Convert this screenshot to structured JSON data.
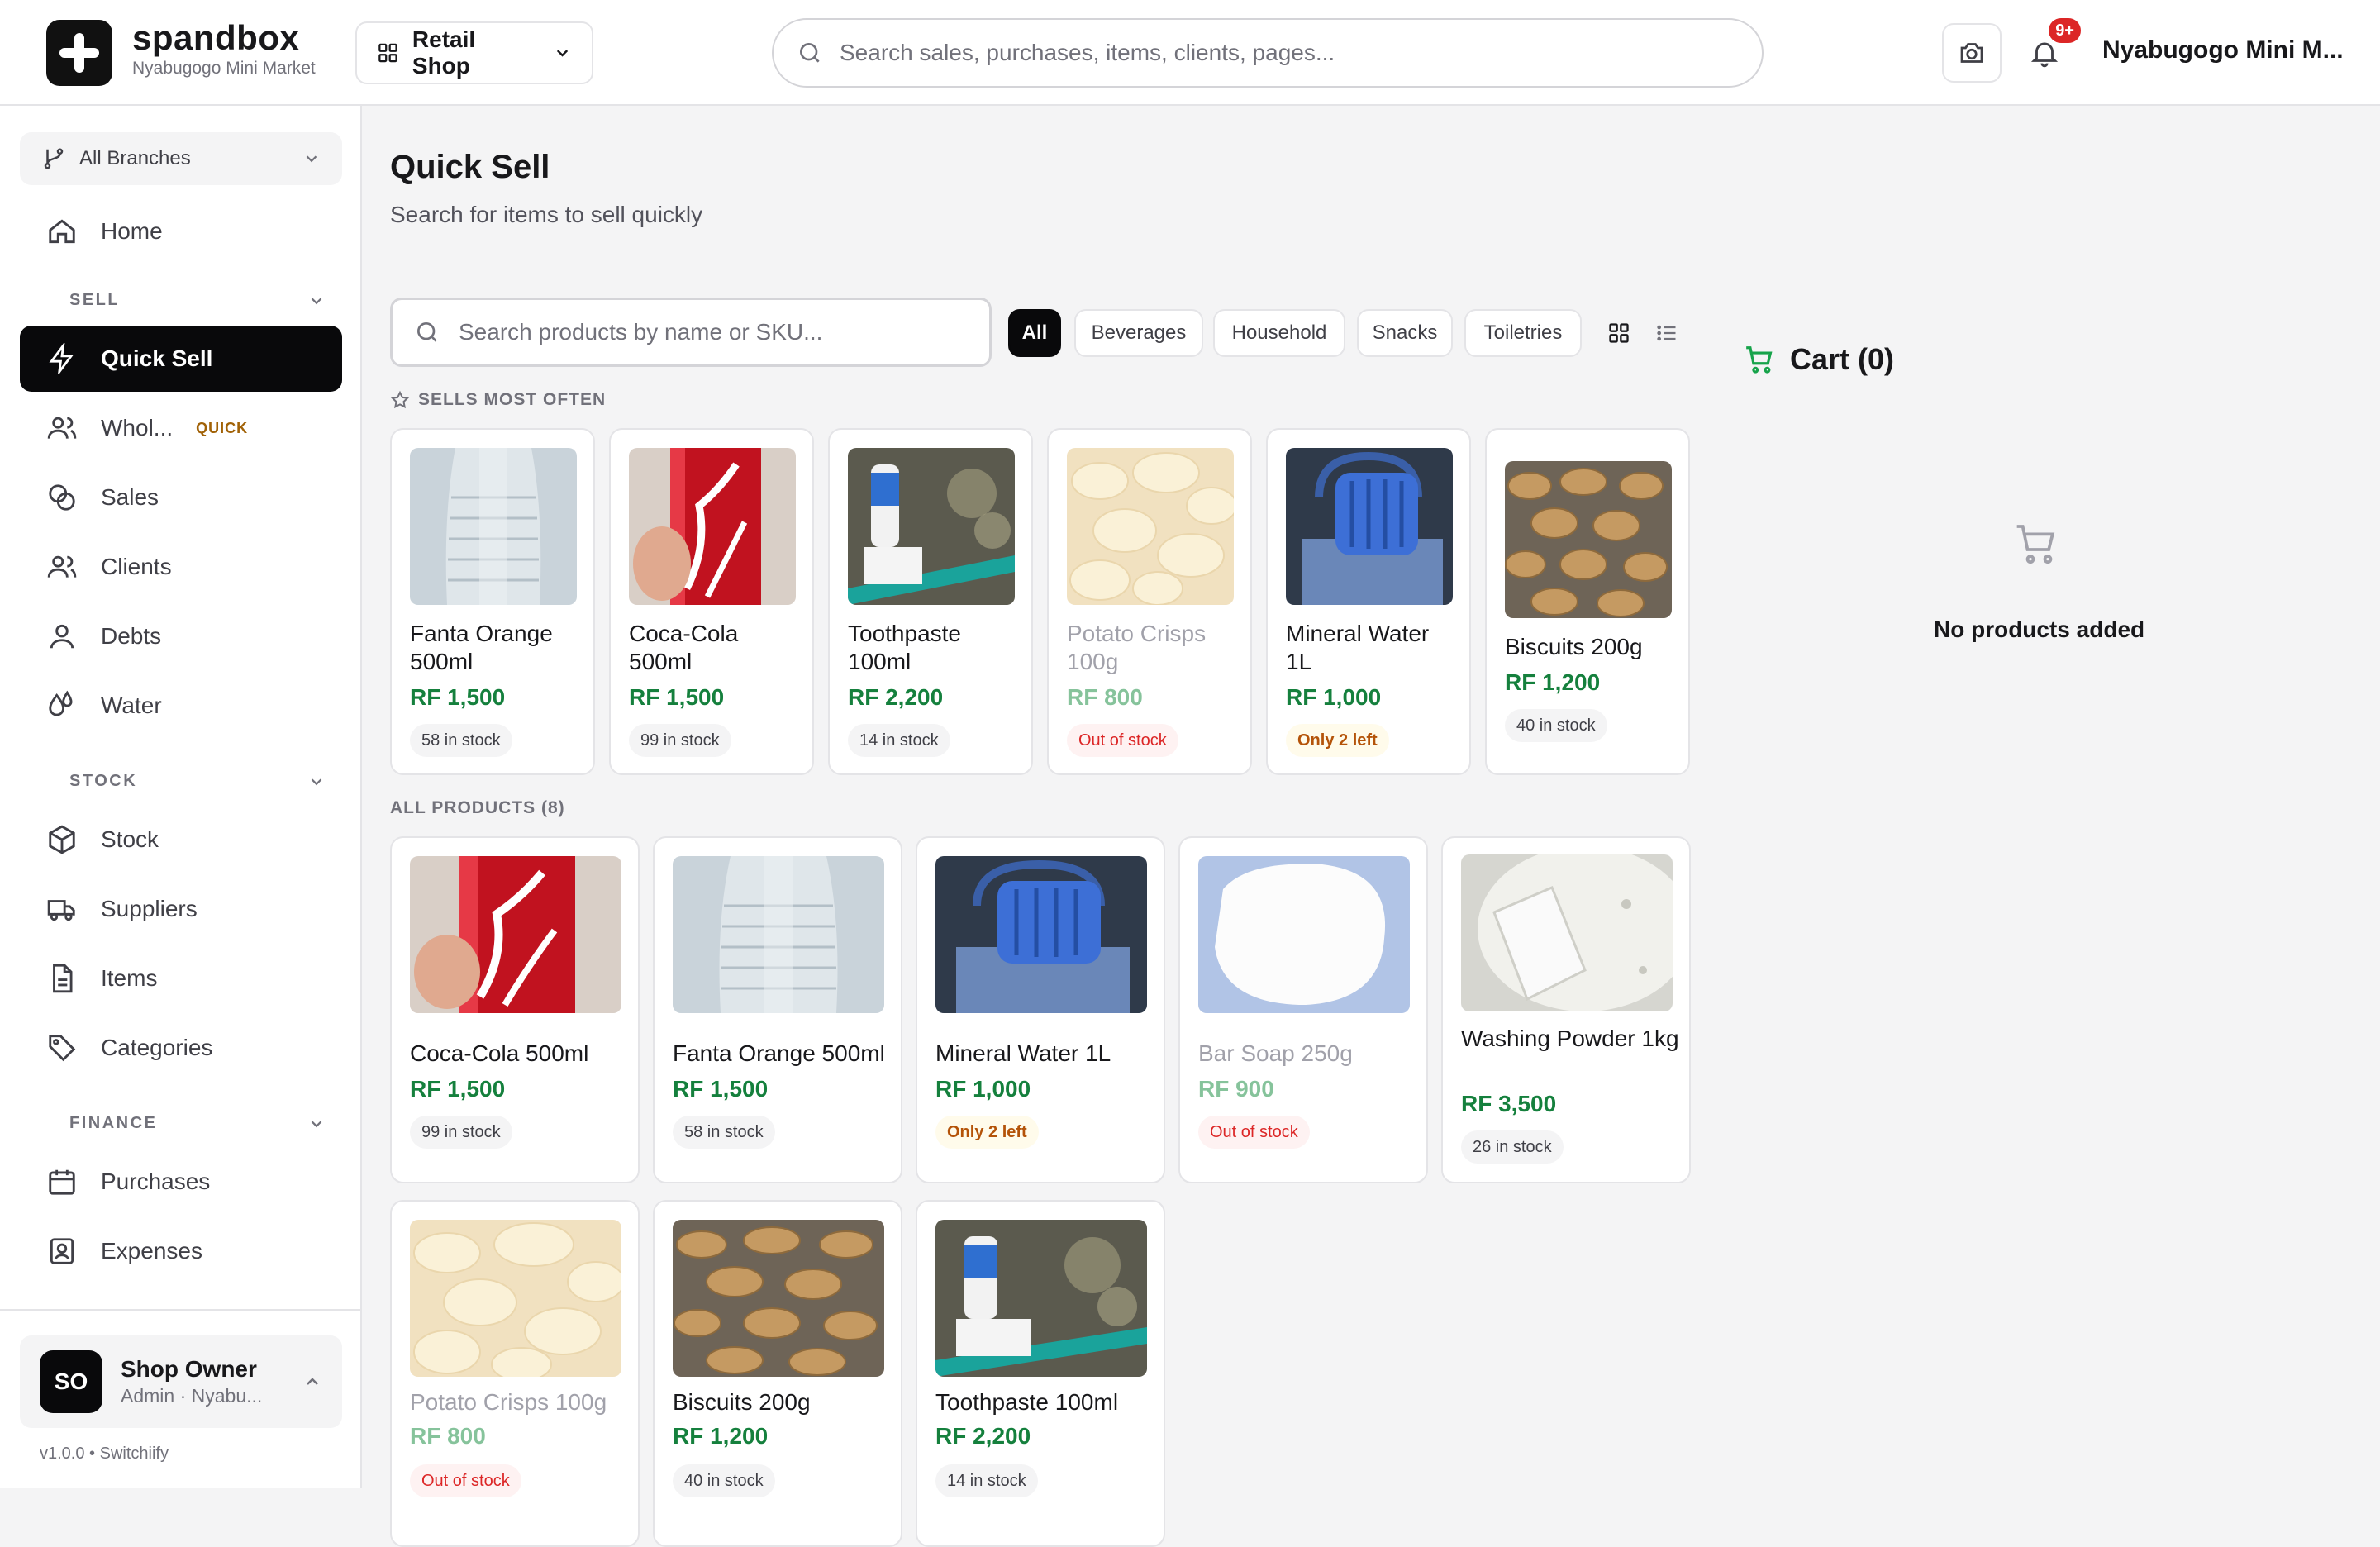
{
  "app": {
    "name": "spandbox",
    "store": "Nyabugogo Mini Market"
  },
  "header": {
    "shop_type": "Retail Shop",
    "search_placeholder": "Search sales, purchases, items, clients, pages...",
    "notifications_badge": "9+",
    "user_name": "Nyabugogo Mini M..."
  },
  "sidebar": {
    "branch": "All Branches",
    "home": "Home",
    "sections": {
      "sell": "SELL",
      "stock": "STOCK",
      "finance": "FINANCE"
    },
    "sell_items": [
      "Quick Sell",
      "Whol...",
      "Sales",
      "Clients",
      "Debts",
      "Water"
    ],
    "quick_badge": "QUICK",
    "stock_items": [
      "Stock",
      "Suppliers",
      "Items",
      "Categories"
    ],
    "finance_items": [
      "Purchases",
      "Expenses"
    ],
    "profile": {
      "initials": "SO",
      "name": "Shop Owner",
      "role": "Admin · Nyabu..."
    },
    "version": "v1.0.0 • Switchiify"
  },
  "main": {
    "title": "Quick Sell",
    "subtitle": "Search for items to sell quickly",
    "search_placeholder": "Search products by name or SKU...",
    "filters": [
      "All",
      "Beverages",
      "Household",
      "Snacks",
      "Toiletries"
    ],
    "active_filter": "All",
    "sells_most_often_label": "SELLS MOST OFTEN",
    "all_products_label": "ALL PRODUCTS (8)",
    "most_often": [
      {
        "name": "Fanta Orange 500ml",
        "price": "RF 1,500",
        "stock": "58 in stock",
        "status": "ok",
        "image": "bottle"
      },
      {
        "name": "Coca-Cola 500ml",
        "price": "RF 1,500",
        "stock": "99 in stock",
        "status": "ok",
        "image": "can"
      },
      {
        "name": "Toothpaste 100ml",
        "price": "RF 2,200",
        "stock": "14 in stock",
        "status": "ok",
        "image": "toothbrush"
      },
      {
        "name": "Potato Crisps 100g",
        "price": "RF 800",
        "stock": "Out of stock",
        "status": "out",
        "image": "crisps"
      },
      {
        "name": "Mineral Water 1L",
        "price": "RF 1,000",
        "stock": "Only 2 left",
        "status": "low",
        "image": "water"
      },
      {
        "name": "Biscuits 200g",
        "price": "RF 1,200",
        "stock": "40 in stock",
        "status": "ok",
        "image": "biscuits"
      }
    ],
    "all_products": [
      {
        "name": "Coca-Cola 500ml",
        "price": "RF 1,500",
        "stock": "99 in stock",
        "status": "ok",
        "image": "can"
      },
      {
        "name": "Fanta Orange 500ml",
        "price": "RF 1,500",
        "stock": "58 in stock",
        "status": "ok",
        "image": "bottle"
      },
      {
        "name": "Mineral Water 1L",
        "price": "RF 1,000",
        "stock": "Only 2 left",
        "status": "low",
        "image": "water"
      },
      {
        "name": "Bar Soap 250g",
        "price": "RF 900",
        "stock": "Out of stock",
        "status": "out",
        "image": "soap"
      },
      {
        "name": "Washing Powder 1kg",
        "price": "RF 3,500",
        "stock": "26 in stock",
        "status": "ok",
        "image": "powder"
      },
      {
        "name": "Potato Crisps 100g",
        "price": "RF 800",
        "stock": "Out of stock",
        "status": "out",
        "image": "crisps"
      },
      {
        "name": "Biscuits 200g",
        "price": "RF 1,200",
        "stock": "40 in stock",
        "status": "ok",
        "image": "biscuits"
      },
      {
        "name": "Toothpaste 100ml",
        "price": "RF 2,200",
        "stock": "14 in stock",
        "status": "ok",
        "image": "toothbrush"
      }
    ]
  },
  "cart": {
    "title": "Cart (0)",
    "empty_text": "No products added"
  },
  "colors": {
    "accent": "#09090b",
    "price": "#15803d",
    "danger": "#dc2626",
    "warning": "#b45309"
  }
}
